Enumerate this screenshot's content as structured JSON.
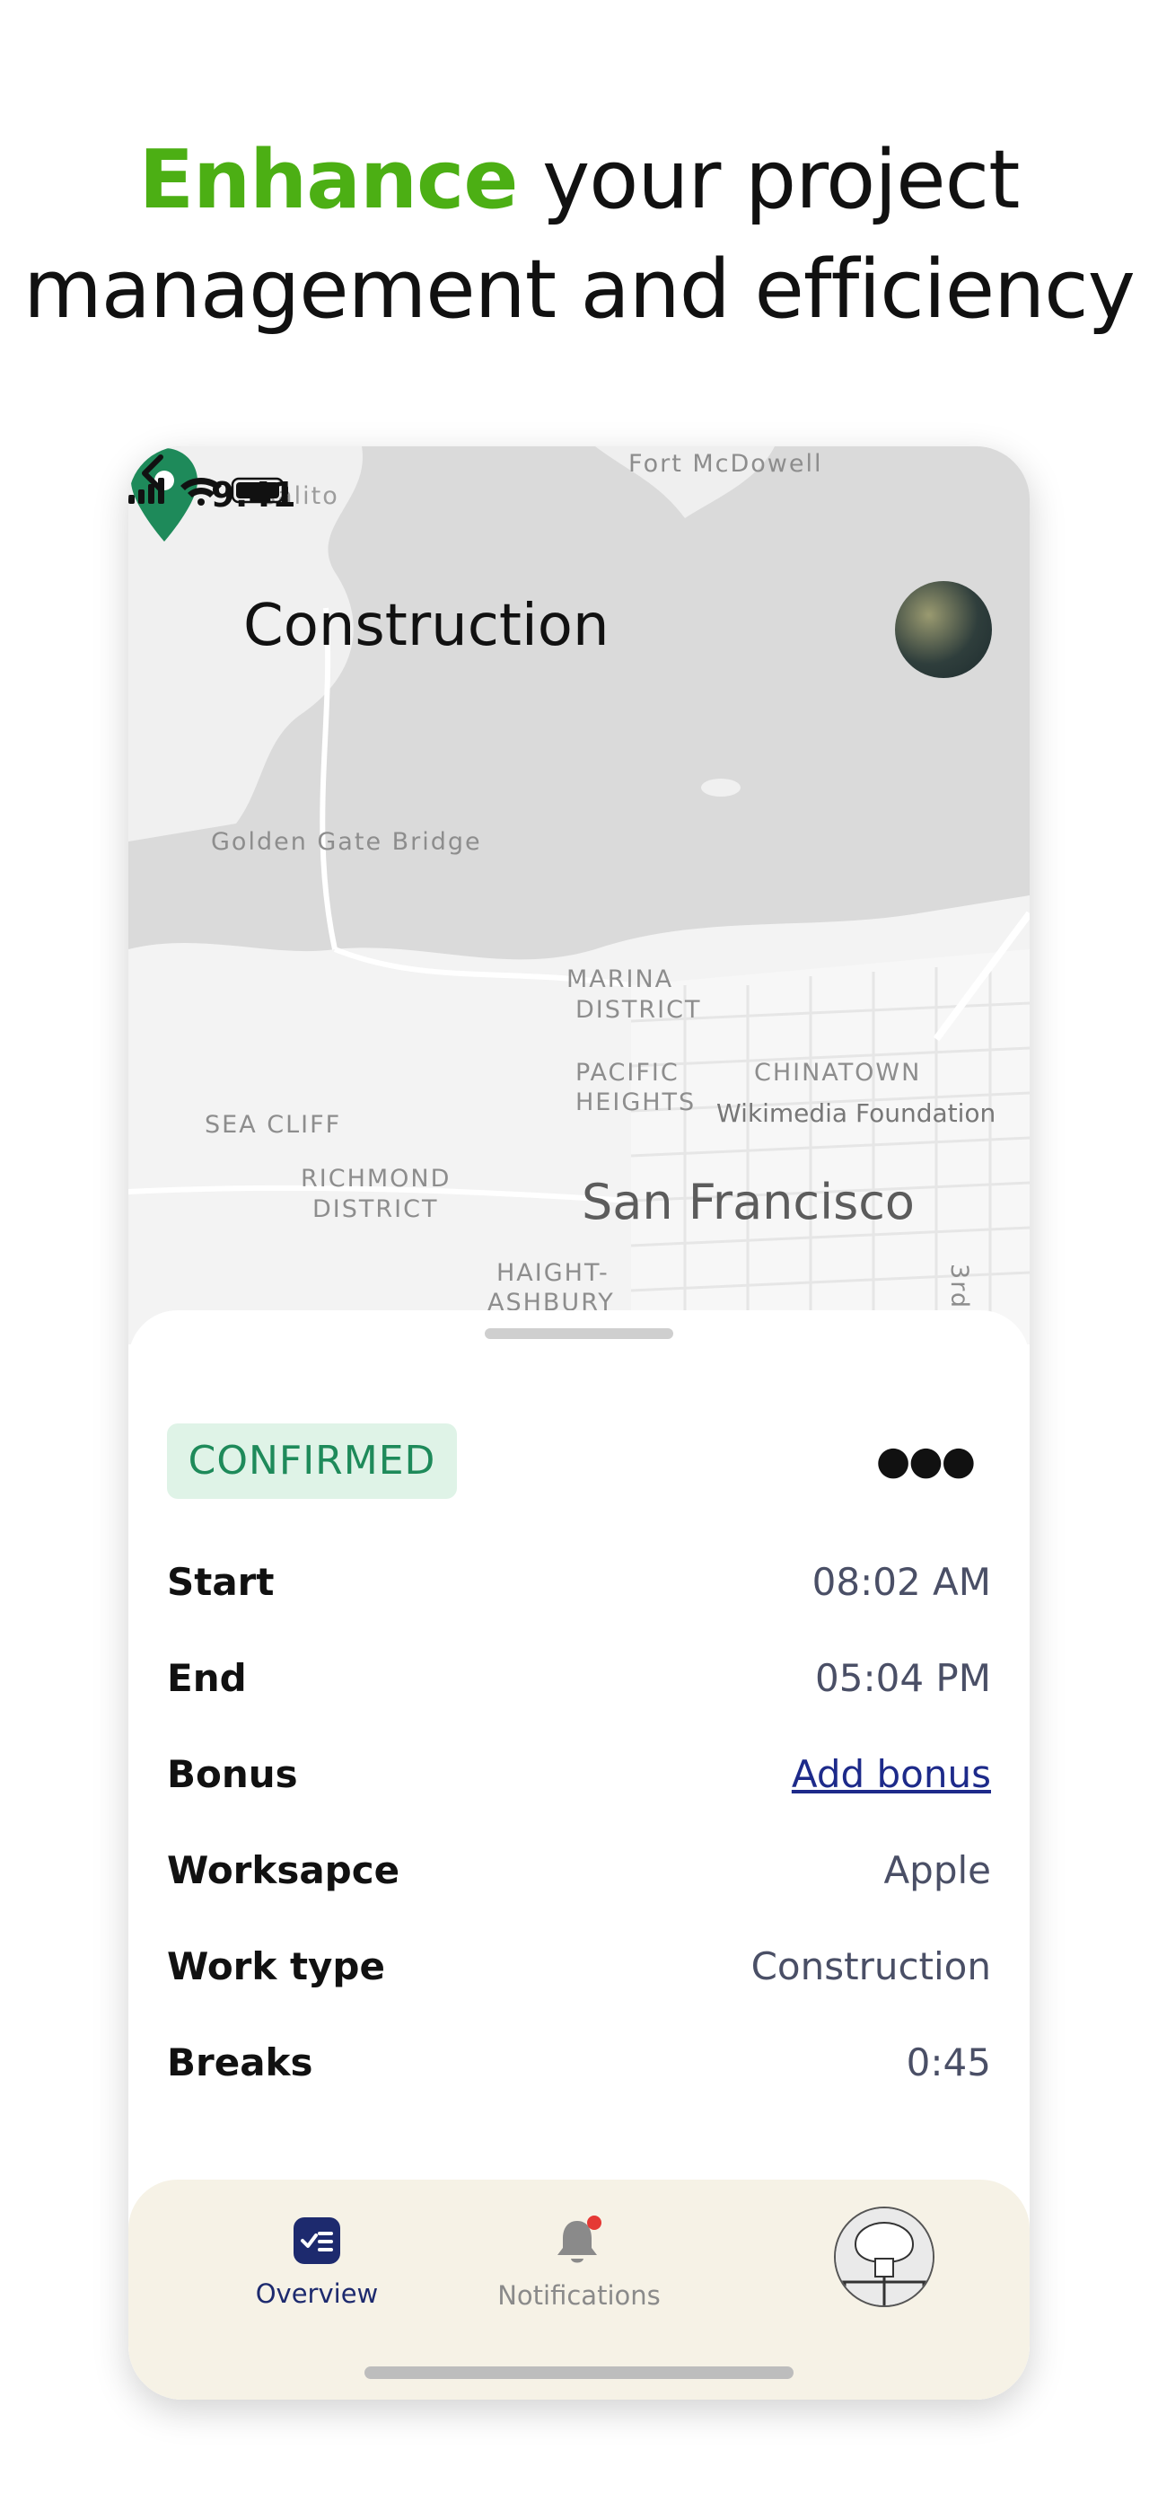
{
  "headline": {
    "accent": "Enhance",
    "rest_line1": "your project",
    "line2": "management and efficiency"
  },
  "statusbar": {
    "time": "9:41"
  },
  "header": {
    "title": "Construction"
  },
  "map": {
    "labels": {
      "sausalito": "salito",
      "fort": "Fort McDowell",
      "ggb": "Golden Gate Bridge",
      "marina": "MARINA",
      "district1": "DISTRICT",
      "pacific": "PACIFIC",
      "heights": "HEIGHTS",
      "chinatown": "CHINATOWN",
      "wikimedia": "Wikimedia Foundation",
      "seacliff": "SEA CLIFF",
      "richmond": "RICHMOND",
      "district2": "DISTRICT",
      "sf": "San Francisco",
      "haight": "HAIGHT-",
      "ashbury": "ASHBURY",
      "third": "3rd"
    },
    "pin_color": "#1e8a5a"
  },
  "job": {
    "status": "CONFIRMED",
    "rows": [
      {
        "label": "Start",
        "value": "08:02 AM"
      },
      {
        "label": "End",
        "value": "05:04 PM"
      },
      {
        "label": "Bonus",
        "value": "Add bonus"
      },
      {
        "label": "Worksapce",
        "value": "Apple"
      },
      {
        "label": "Work type",
        "value": "Construction"
      },
      {
        "label": "Breaks",
        "value": "0:45"
      }
    ]
  },
  "tabs": {
    "overview": "Overview",
    "notifications": "Notifications"
  },
  "colors": {
    "accent": "#4caf14",
    "badge_bg": "#dff3e7",
    "badge_text": "#1e8a5a",
    "link": "#1d2a8a",
    "tabbar_bg": "#f6f2e6",
    "notification_dot": "#e53935"
  }
}
